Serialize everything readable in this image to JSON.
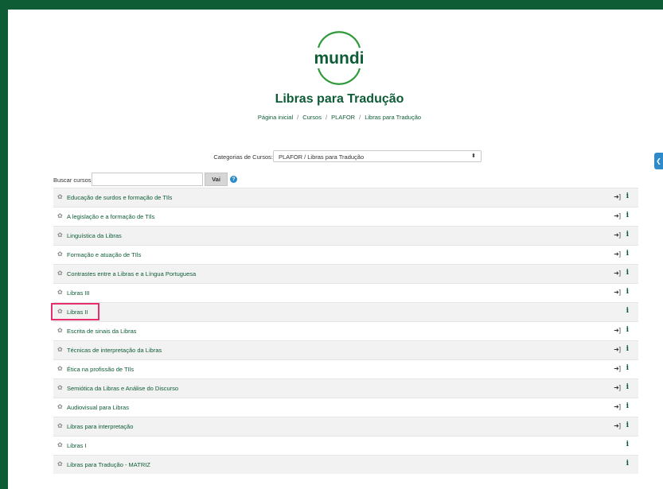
{
  "header": {
    "logo_text": "mundi",
    "course_title": "Libras para Tradução",
    "breadcrumb": [
      "Página inicial",
      "Cursos",
      "PLAFOR",
      "Libras para Tradução"
    ]
  },
  "category": {
    "label": "Categorias de Cursos:",
    "selected": "PLAFOR / Libras para Tradução"
  },
  "search": {
    "label": "Buscar cursos",
    "value": "",
    "button": "Vai",
    "help": "?"
  },
  "courses": [
    {
      "name": "Educação de surdos e formação de TIls",
      "enrol": true
    },
    {
      "name": "A legislação e a formação de TIls",
      "enrol": true
    },
    {
      "name": "Linguística da Libras",
      "enrol": true
    },
    {
      "name": "Formação e atuação de TIls",
      "enrol": true
    },
    {
      "name": "Contrastes entre a Libras e a Língua Portuguesa",
      "enrol": true
    },
    {
      "name": "Libras III",
      "enrol": true
    },
    {
      "name": "Libras II",
      "enrol": false
    },
    {
      "name": "Escrita de sinais da Libras",
      "enrol": true
    },
    {
      "name": "Técnicas de interpretação da Libras",
      "enrol": true
    },
    {
      "name": "Ética na profissão de TIls",
      "enrol": true
    },
    {
      "name": "Semiótica da Libras e Análise do Discurso",
      "enrol": true
    },
    {
      "name": "Audiovisual para Libras",
      "enrol": true
    },
    {
      "name": "Libras para interpretação",
      "enrol": true
    },
    {
      "name": "Libras I",
      "enrol": false
    },
    {
      "name": "Libras para Tradução - MATRIZ",
      "enrol": false
    }
  ],
  "icons": {
    "course": "course-icon",
    "enrol": "enrol-icon",
    "info": "info-icon"
  },
  "colors": {
    "frame": "#0d5c35",
    "link": "#0d5c35",
    "highlight": "#e5306c",
    "accent": "#2e8ac9"
  }
}
